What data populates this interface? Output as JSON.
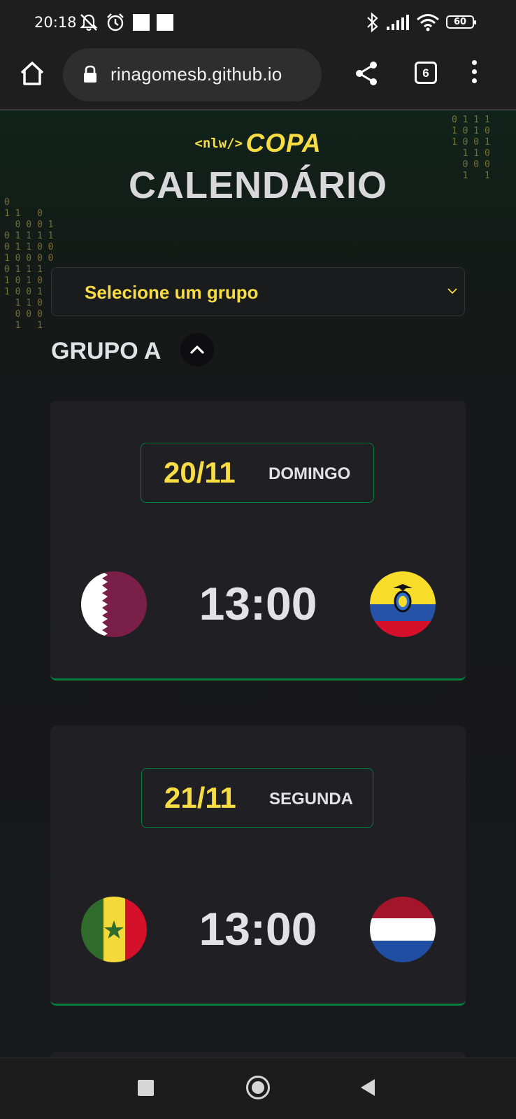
{
  "status_bar": {
    "time": "20:18",
    "icons": [
      "mute-alarm-icon",
      "alarm-clock-icon",
      "notification-square-icon",
      "notification-square-icon",
      "bluetooth-icon",
      "signal-icon",
      "wifi-icon",
      "battery-icon"
    ],
    "battery": "60"
  },
  "browser": {
    "url": "rinagomesb.github.io",
    "tab_count": "6",
    "icons": [
      "home-icon",
      "lock-icon",
      "share-icon",
      "tabs-icon",
      "more-vert-icon"
    ]
  },
  "header": {
    "logo_tag": "<nlw/>",
    "logo_word": "COPA",
    "title": "CALENDÁRIO"
  },
  "group_select": {
    "value": "Selecione um grupo"
  },
  "group": {
    "title": "GRUPO A"
  },
  "matches": [
    {
      "date": "20/11",
      "weekday": "DOMINGO",
      "time": "13:00",
      "home_flag": "qatar-flag-icon",
      "away_flag": "ecuador-flag-icon"
    },
    {
      "date": "21/11",
      "weekday": "SEGUNDA",
      "time": "13:00",
      "home_flag": "senegal-flag-icon",
      "away_flag": "netherlands-flag-icon"
    }
  ],
  "decoration": {
    "binary_right": "0 1 1 1\n1 0 1 0\n1 0 0 1\n  1 1 0\n  0 0 0\n  1   1",
    "binary_left": "0\n1 1   0\n  0 0 0 1\n0 1 1 1 1\n0 1 1 0 0\n1 0 0 0 0\n0 1 1 1\n1 0 1 0\n1 0 0 1\n  1 1 0\n  0 0 0\n  1   1"
  },
  "colors": {
    "accent_yellow": "#F7DD43",
    "accent_green": "#047C3F",
    "card_bg": "#202024",
    "page_bg": "#121214"
  },
  "navigation_bar": {
    "icons": [
      "recents-square-icon",
      "home-circle-icon",
      "back-triangle-icon"
    ]
  }
}
